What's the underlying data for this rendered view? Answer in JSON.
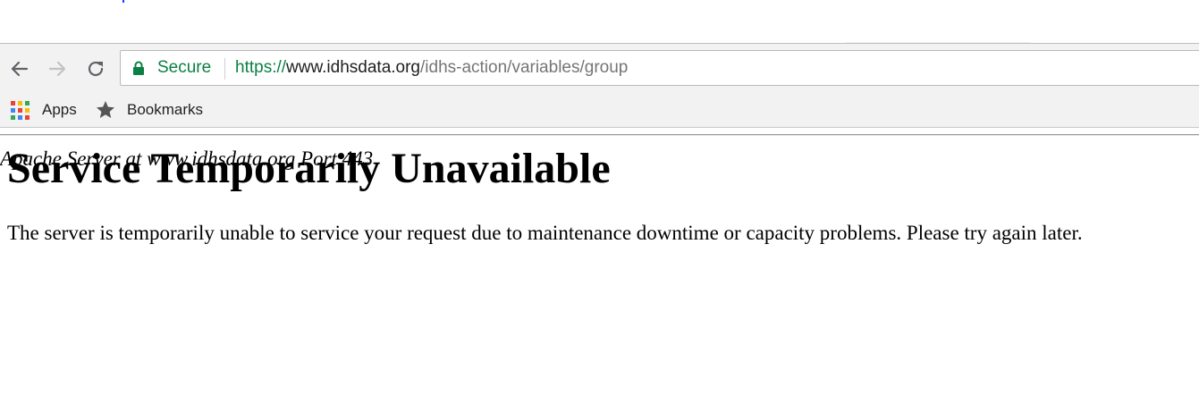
{
  "browser": {
    "security_label": "Secure",
    "url": {
      "scheme": "https://",
      "host": "www.idhsdata.org",
      "path": "/idhs-action/variables/group"
    },
    "bookmarks_bar": {
      "items": [
        {
          "label": "Apps",
          "icon": "apps-grid-icon"
        },
        {
          "label": "Bookmarks",
          "icon": "star-icon"
        }
      ]
    },
    "nav_icons": [
      "back-arrow-icon",
      "forward-arrow-icon",
      "reload-icon"
    ],
    "colors": {
      "secure_green": "#0b8043",
      "toolbar_bg": "#f2f2f2"
    }
  },
  "page": {
    "title": "Service Temporarily Unavailable",
    "message": "The server is temporarily unable to service your request due to maintenance downtime or capacity problems. Please try again later.",
    "signature": "Apache Server at www.idhsdata.org Port 443"
  }
}
